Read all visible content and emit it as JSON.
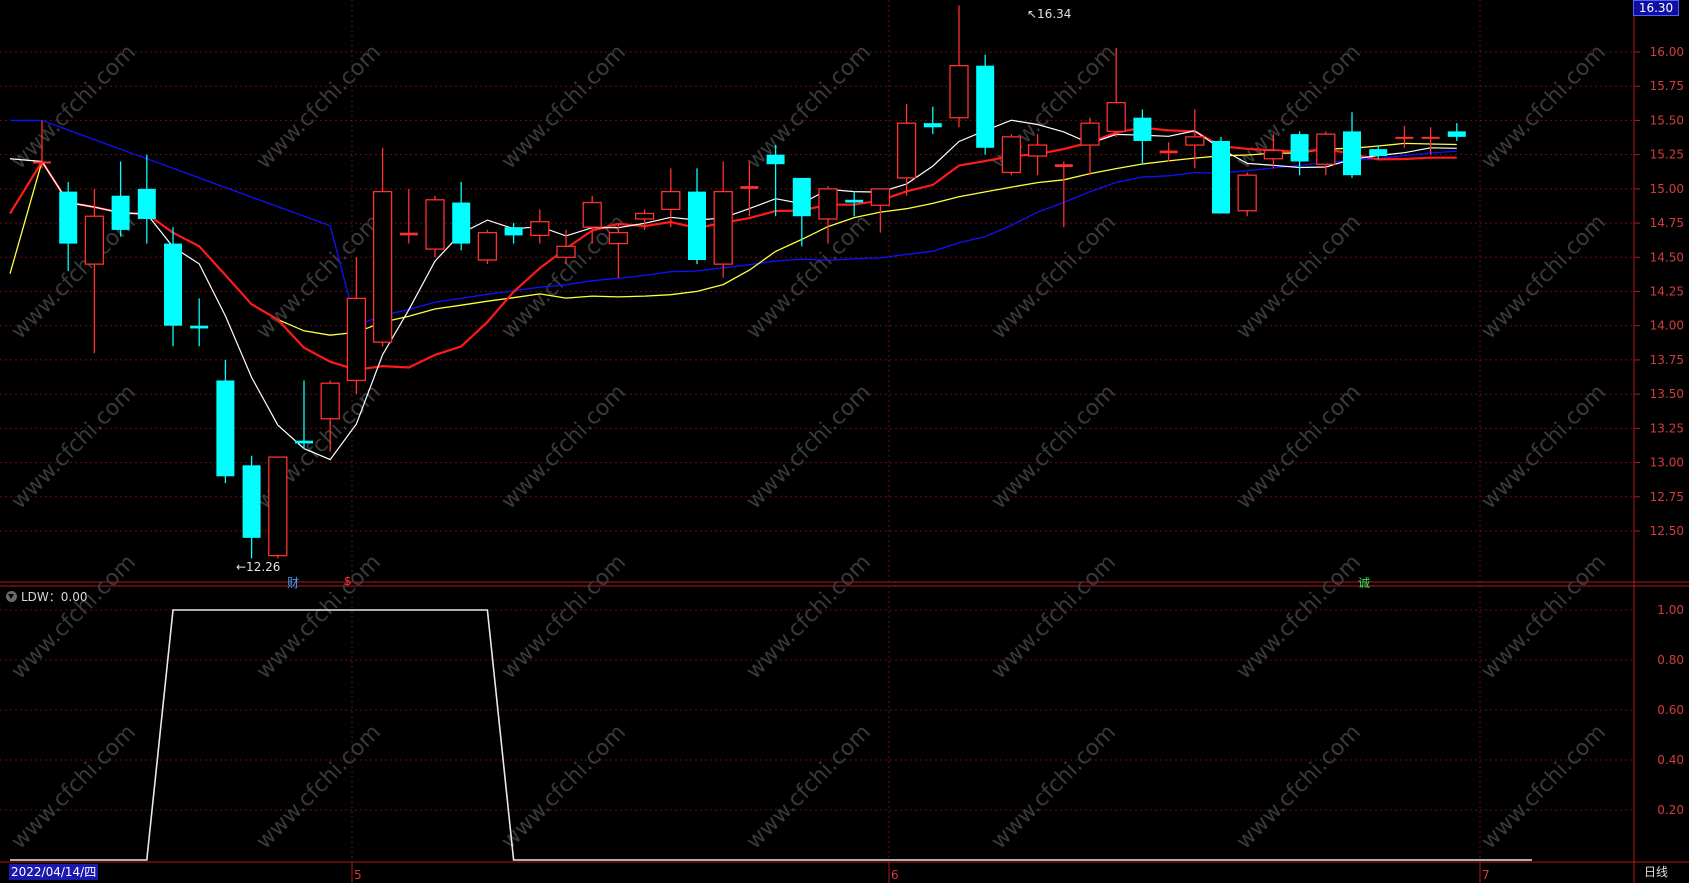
{
  "window": {
    "current_price_label": "16.30",
    "start_date": "2022/04/14/四",
    "period_label": "日线"
  },
  "price_axis": {
    "ticks": [
      "16.00",
      "15.75",
      "15.50",
      "15.25",
      "15.00",
      "14.75",
      "14.50",
      "14.25",
      "14.00",
      "13.75",
      "13.50",
      "13.25",
      "13.00",
      "12.75",
      "12.50"
    ]
  },
  "indicator": {
    "title": "LDW：0.00",
    "axis_ticks": [
      "1.00",
      "0.80",
      "0.60",
      "0.40",
      "0.20"
    ]
  },
  "annotations": {
    "high_label": "16.34",
    "low_label": "12.26"
  },
  "event_markers": [
    {
      "text": "财",
      "color": "#3aa0ff"
    },
    {
      "text": "$",
      "color": "#ff3030"
    },
    {
      "text": "诚",
      "color": "#40e060"
    }
  ],
  "x_axis": {
    "month_labels": [
      "5",
      "6",
      "7"
    ]
  },
  "watermark": "www.cfchi.com",
  "colors": {
    "up": "#ff3030",
    "down": "#00ffff",
    "ma_short": "#ffffff",
    "ma_mid": "#ff1a1a",
    "ma_long": "#ffff40",
    "ma_longest": "#1010ff"
  },
  "chart_data": {
    "type": "candlestick",
    "price_range": [
      12.2,
      16.4
    ],
    "candles": [
      {
        "o": 15.2,
        "c": 15.2,
        "h": 15.5,
        "l": 15.15
      },
      {
        "o": 14.98,
        "c": 14.6,
        "h": 15.05,
        "l": 14.4
      },
      {
        "o": 14.45,
        "c": 14.8,
        "h": 15.0,
        "l": 13.8
      },
      {
        "o": 14.95,
        "c": 14.7,
        "h": 15.2,
        "l": 14.65
      },
      {
        "o": 15.0,
        "c": 14.78,
        "h": 15.25,
        "l": 14.6
      },
      {
        "o": 14.6,
        "c": 14.0,
        "h": 14.72,
        "l": 13.85
      },
      {
        "o": 14.0,
        "c": 13.98,
        "h": 14.2,
        "l": 13.85
      },
      {
        "o": 13.6,
        "c": 12.9,
        "h": 13.75,
        "l": 12.85
      },
      {
        "o": 12.98,
        "c": 12.45,
        "h": 13.05,
        "l": 12.3
      },
      {
        "o": 12.32,
        "c": 13.04,
        "h": 13.04,
        "l": 12.3
      },
      {
        "o": 13.16,
        "c": 13.14,
        "h": 13.6,
        "l": 13.1
      },
      {
        "o": 13.32,
        "c": 13.58,
        "h": 13.6,
        "l": 13.08
      },
      {
        "o": 13.6,
        "c": 14.2,
        "h": 14.5,
        "l": 13.5
      },
      {
        "o": 13.88,
        "c": 14.98,
        "h": 15.3,
        "l": 13.85
      },
      {
        "o": 14.66,
        "c": 14.68,
        "h": 15.0,
        "l": 14.6
      },
      {
        "o": 14.56,
        "c": 14.92,
        "h": 14.95,
        "l": 14.5
      },
      {
        "o": 14.9,
        "c": 14.6,
        "h": 15.05,
        "l": 14.55
      },
      {
        "o": 14.48,
        "c": 14.68,
        "h": 14.7,
        "l": 14.45
      },
      {
        "o": 14.72,
        "c": 14.66,
        "h": 14.75,
        "l": 14.6
      },
      {
        "o": 14.66,
        "c": 14.76,
        "h": 14.85,
        "l": 14.6
      },
      {
        "o": 14.5,
        "c": 14.58,
        "h": 14.7,
        "l": 14.45
      },
      {
        "o": 14.72,
        "c": 14.9,
        "h": 14.95,
        "l": 14.6
      },
      {
        "o": 14.6,
        "c": 14.68,
        "h": 14.75,
        "l": 14.35
      },
      {
        "o": 14.78,
        "c": 14.82,
        "h": 14.85,
        "l": 14.7
      },
      {
        "o": 14.85,
        "c": 14.98,
        "h": 15.15,
        "l": 14.72
      },
      {
        "o": 14.98,
        "c": 14.48,
        "h": 15.15,
        "l": 14.45
      },
      {
        "o": 14.45,
        "c": 14.98,
        "h": 15.2,
        "l": 14.35
      },
      {
        "o": 15.0,
        "c": 15.02,
        "h": 15.2,
        "l": 14.8
      },
      {
        "o": 15.25,
        "c": 15.18,
        "h": 15.32,
        "l": 14.8
      },
      {
        "o": 15.08,
        "c": 14.8,
        "h": 15.08,
        "l": 14.58
      },
      {
        "o": 14.78,
        "c": 15.0,
        "h": 15.02,
        "l": 14.6
      },
      {
        "o": 14.92,
        "c": 14.9,
        "h": 14.98,
        "l": 14.8
      },
      {
        "o": 14.88,
        "c": 15.0,
        "h": 15.0,
        "l": 14.68
      },
      {
        "o": 15.08,
        "c": 15.48,
        "h": 15.62,
        "l": 14.95
      },
      {
        "o": 15.48,
        "c": 15.45,
        "h": 15.6,
        "l": 15.4
      },
      {
        "o": 15.52,
        "c": 15.9,
        "h": 16.34,
        "l": 15.45
      },
      {
        "o": 15.9,
        "c": 15.3,
        "h": 15.98,
        "l": 15.25
      },
      {
        "o": 15.12,
        "c": 15.38,
        "h": 15.4,
        "l": 15.1
      },
      {
        "o": 15.24,
        "c": 15.32,
        "h": 15.4,
        "l": 15.1
      },
      {
        "o": 15.16,
        "c": 15.18,
        "h": 15.2,
        "l": 14.72
      },
      {
        "o": 15.32,
        "c": 15.48,
        "h": 15.52,
        "l": 15.1
      },
      {
        "o": 15.42,
        "c": 15.63,
        "h": 16.03,
        "l": 15.38
      },
      {
        "o": 15.52,
        "c": 15.35,
        "h": 15.58,
        "l": 15.18
      },
      {
        "o": 15.26,
        "c": 15.28,
        "h": 15.34,
        "l": 15.2
      },
      {
        "o": 15.32,
        "c": 15.38,
        "h": 15.58,
        "l": 15.15
      },
      {
        "o": 15.35,
        "c": 14.82,
        "h": 15.38,
        "l": 14.82
      },
      {
        "o": 14.84,
        "c": 15.1,
        "h": 15.12,
        "l": 14.8
      },
      {
        "o": 15.22,
        "c": 15.28,
        "h": 15.4,
        "l": 15.15
      },
      {
        "o": 15.4,
        "c": 15.2,
        "h": 15.42,
        "l": 15.1
      },
      {
        "o": 15.18,
        "c": 15.4,
        "h": 15.42,
        "l": 15.1
      },
      {
        "o": 15.42,
        "c": 15.1,
        "h": 15.56,
        "l": 15.08
      },
      {
        "o": 15.29,
        "c": 15.24,
        "h": 15.32,
        "l": 15.22
      },
      {
        "o": 15.38,
        "c": 15.38,
        "h": 15.46,
        "l": 15.3
      },
      {
        "o": 15.38,
        "c": 15.38,
        "h": 15.45,
        "l": 15.25
      },
      {
        "o": 15.42,
        "c": 15.38,
        "h": 15.48,
        "l": 15.35
      }
    ],
    "ldw": [
      0,
      0,
      0,
      0,
      0,
      1,
      1,
      1,
      1,
      1,
      1,
      1,
      1,
      1,
      1,
      1,
      1,
      1,
      0,
      0,
      0,
      0,
      0,
      0,
      0,
      0,
      0,
      0,
      0,
      0,
      0,
      0,
      0,
      0,
      0,
      0,
      0,
      0,
      0,
      0,
      0,
      0,
      0,
      0,
      0,
      0,
      0,
      0,
      0,
      0,
      0,
      0,
      0,
      0,
      0
    ]
  }
}
